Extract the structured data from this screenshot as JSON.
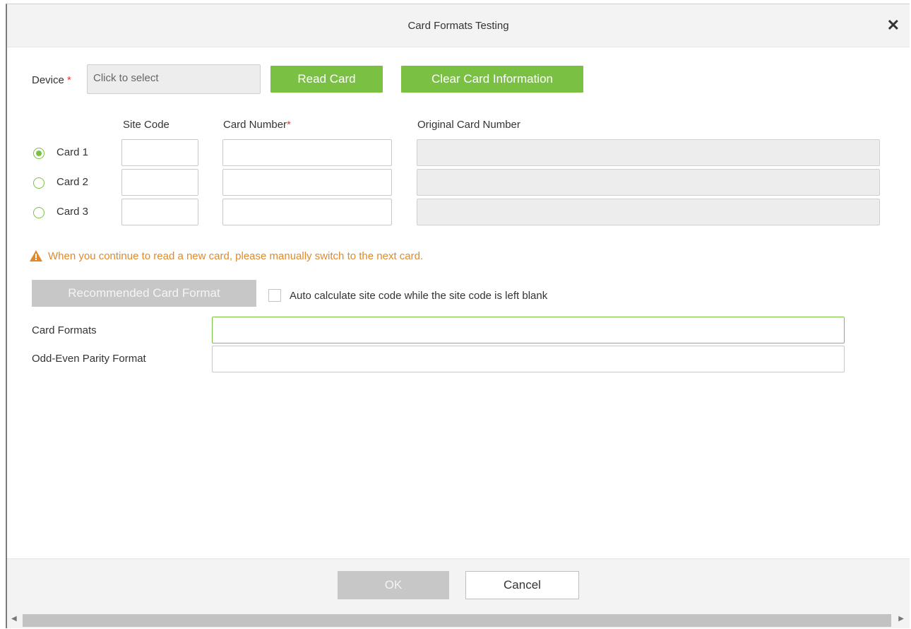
{
  "dialog": {
    "title": "Card Formats Testing",
    "close_symbol": "✕"
  },
  "device": {
    "label": "Device",
    "required_mark": "*",
    "placeholder": "Click to select"
  },
  "buttons": {
    "read_card": "Read Card",
    "clear_card_info": "Clear Card Information",
    "recommended_card_format": "Recommended Card Format",
    "ok": "OK",
    "cancel": "Cancel"
  },
  "columns": {
    "site_code": "Site Code",
    "card_number": "Card Number",
    "card_number_required": "*",
    "original_card_number": "Original Card Number"
  },
  "cards": [
    {
      "label": "Card 1",
      "selected": true,
      "site_code": "",
      "card_number": "",
      "original_card_number": ""
    },
    {
      "label": "Card 2",
      "selected": false,
      "site_code": "",
      "card_number": "",
      "original_card_number": ""
    },
    {
      "label": "Card 3",
      "selected": false,
      "site_code": "",
      "card_number": "",
      "original_card_number": ""
    }
  ],
  "warning": {
    "icon": "warning-triangle-icon",
    "text": "When you continue to read a new card, please manually switch to the next card."
  },
  "auto_calc": {
    "label": "Auto calculate site code while the site code is left blank",
    "checked": false
  },
  "fields": {
    "card_formats_label": "Card Formats",
    "card_formats_value": "",
    "odd_even_label": "Odd-Even Parity Format",
    "odd_even_value": ""
  },
  "colors": {
    "accent_green": "#7ac143",
    "warning_orange": "#e08a2b",
    "required_red": "#e23b3b",
    "disabled_gray": "#c7c7c7"
  }
}
